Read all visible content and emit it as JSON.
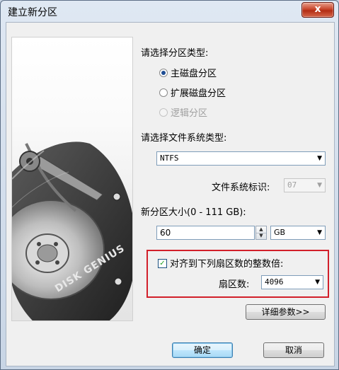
{
  "window": {
    "title": "建立新分区",
    "close_glyph": "x"
  },
  "art": {
    "brand_text": "DISK GENIUS"
  },
  "partition_type": {
    "label": "请选择分区类型:",
    "options": [
      {
        "label": "主磁盘分区",
        "selected": true,
        "enabled": true
      },
      {
        "label": "扩展磁盘分区",
        "selected": false,
        "enabled": true
      },
      {
        "label": "逻辑分区",
        "selected": false,
        "enabled": false
      }
    ]
  },
  "fs_type": {
    "label": "请选择文件系统类型:",
    "value": "NTFS"
  },
  "fs_id": {
    "label": "文件系统标识:",
    "value": "07"
  },
  "size": {
    "label": "新分区大小(0 - 111 GB):",
    "value": "60",
    "unit": "GB"
  },
  "align": {
    "checked": true,
    "label": "对齐到下列扇区数的整数倍:",
    "sector_label": "扇区数:",
    "sector_value": "4096"
  },
  "buttons": {
    "details": "详细参数>>",
    "ok": "确定",
    "cancel": "取消"
  }
}
